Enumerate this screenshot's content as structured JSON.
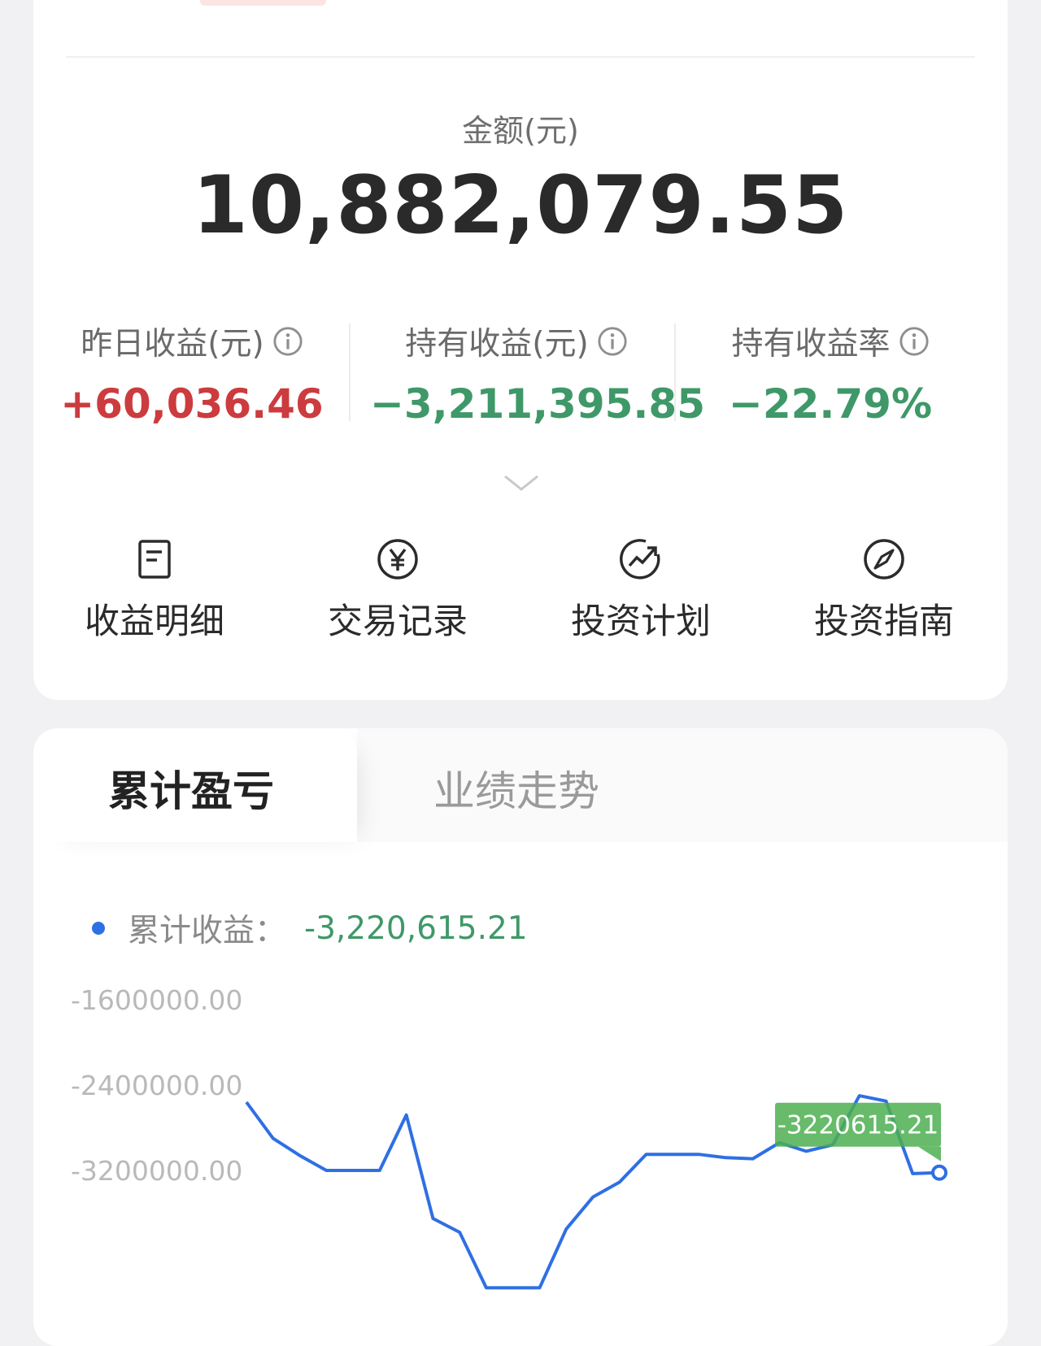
{
  "header": {
    "amount_label": "金额(元)",
    "amount_value": "10,882,079.55"
  },
  "stats": [
    {
      "label": "昨日收益(元)",
      "value": "+60,036.46",
      "tone": "red"
    },
    {
      "label": "持有收益(元)",
      "value": "−3,211,395.85",
      "tone": "green"
    },
    {
      "label": "持有收益率",
      "value": "−22.79%",
      "tone": "green"
    }
  ],
  "actions": [
    {
      "label": "收益明细",
      "icon": "document-icon"
    },
    {
      "label": "交易记录",
      "icon": "yen-circle-icon"
    },
    {
      "label": "投资计划",
      "icon": "trend-up-icon"
    },
    {
      "label": "投资指南",
      "icon": "compass-icon"
    }
  ],
  "tabs": {
    "active": "累计盈亏",
    "inactive": "业绩走势"
  },
  "legend": {
    "label": "累计收益：",
    "value": "-3,220,615.21"
  },
  "colors": {
    "positive": "#cc3b3e",
    "negative": "#3f9868",
    "line": "#2f6fe4",
    "tooltip": "#4caf50"
  },
  "chart_data": {
    "type": "line",
    "y_ticks": [
      "-1600000.00",
      "-2400000.00",
      "-3200000.00"
    ],
    "ylim": [
      -4100000,
      -1600000
    ],
    "series": [
      {
        "name": "累计收益",
        "values": [
          -2560000,
          -2900000,
          -3060000,
          -3200000,
          -3200000,
          -3200000,
          -2680000,
          -3650000,
          -3780000,
          -4300000,
          -4300000,
          -4300000,
          -3750000,
          -3450000,
          -3310000,
          -3050000,
          -3050000,
          -3050000,
          -3080000,
          -3090000,
          -2940000,
          -3020000,
          -2960000,
          -2500000,
          -2550000,
          -3230000,
          -3220615.21
        ]
      }
    ],
    "tooltip_label": "-3220615.21"
  }
}
